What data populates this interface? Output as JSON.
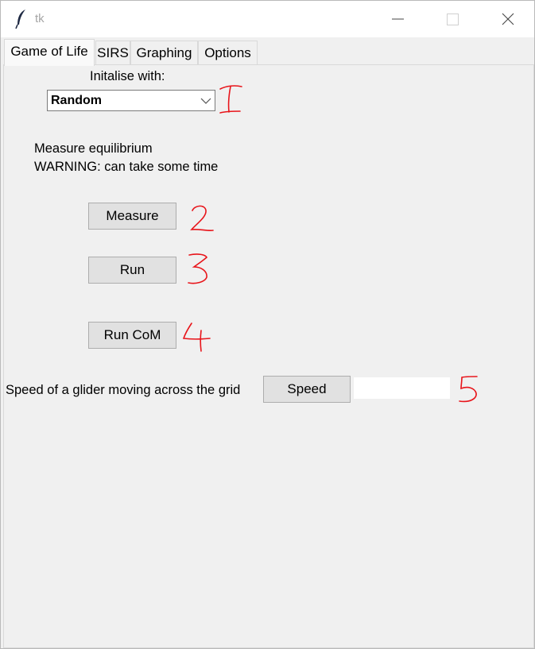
{
  "window": {
    "title": "tk"
  },
  "tabs": [
    {
      "label": "Game of Life",
      "active": true
    },
    {
      "label": "SIRS",
      "active": false
    },
    {
      "label": "Graphing",
      "active": false
    },
    {
      "label": "Options",
      "active": false
    }
  ],
  "init": {
    "label": "Initalise with:",
    "selected": "Random"
  },
  "measure": {
    "line1": "Measure equilibrium",
    "line2": "WARNING: can take some time",
    "button": "Measure"
  },
  "run_button": "Run",
  "run_com_button": "Run CoM",
  "speed": {
    "label": "Speed of a glider moving across the grid",
    "button": "Speed",
    "entry_value": ""
  },
  "annotations": [
    "1",
    "2",
    "3",
    "4",
    "5"
  ],
  "colors": {
    "annotation": "#e8141a",
    "background": "#f0f0f0",
    "button": "#e1e1e1"
  }
}
